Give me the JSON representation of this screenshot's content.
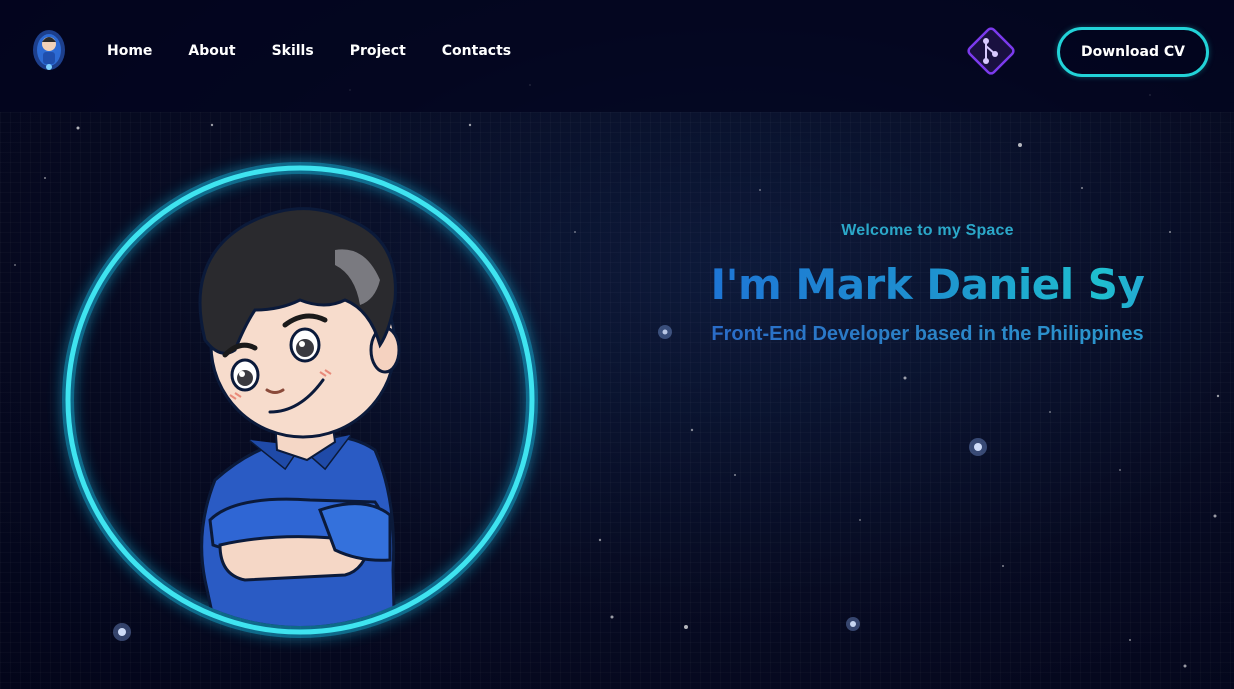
{
  "nav": {
    "logo_icon": "astronaut-avatar-icon",
    "links": [
      "Home",
      "About",
      "Skills",
      "Project",
      "Contacts"
    ],
    "git_icon": "git-branch-icon",
    "cv_button": "Download CV"
  },
  "hero": {
    "welcome": "Welcome to my Space",
    "headline": "I'm Mark Daniel Sy",
    "subtitle": "Front-End Developer based in the Philippines",
    "portrait_icon": "cartoon-portrait-icon"
  },
  "colors": {
    "accent_cyan": "#22d3d8",
    "headline_blue": "#1e6bd8",
    "headline_teal": "#1fbfcf",
    "background": "#070b22",
    "git_badge": "#7c3aed"
  }
}
